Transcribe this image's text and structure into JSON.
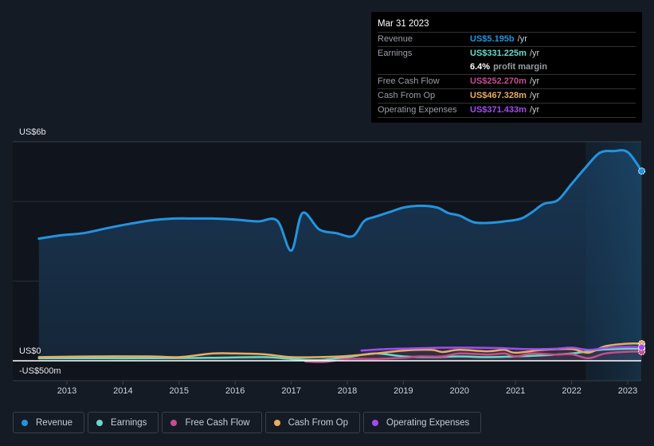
{
  "tooltip": {
    "date": "Mar 31 2023",
    "rows": [
      {
        "label": "Revenue",
        "value": "US$5.195b",
        "unit": "/yr",
        "color": "#2394df"
      },
      {
        "label": "Earnings",
        "value": "US$331.225m",
        "unit": "/yr",
        "color": "#6ad9c8"
      },
      {
        "label": "",
        "value": "6.4%",
        "unit": "profit margin",
        "color": "#ffffff"
      },
      {
        "label": "Free Cash Flow",
        "value": "US$252.270m",
        "unit": "/yr",
        "color": "#c84d8d"
      },
      {
        "label": "Cash From Op",
        "value": "US$467.328m",
        "unit": "/yr",
        "color": "#e8ad5f"
      },
      {
        "label": "Operating Expenses",
        "value": "US$371.433m",
        "unit": "/yr",
        "color": "#a24cf0"
      }
    ]
  },
  "legend": [
    {
      "label": "Revenue",
      "color": "#2394df"
    },
    {
      "label": "Earnings",
      "color": "#6ad9c8"
    },
    {
      "label": "Free Cash Flow",
      "color": "#c84d8d"
    },
    {
      "label": "Cash From Op",
      "color": "#e8ad5f"
    },
    {
      "label": "Operating Expenses",
      "color": "#a24cf0"
    }
  ],
  "chart_data": {
    "type": "area",
    "title": "",
    "xlabel": "",
    "ylabel": "",
    "y_tick_labels": [
      "US$6b",
      "US$0",
      "-US$500m"
    ],
    "x_tick_labels": [
      "2013",
      "2014",
      "2015",
      "2016",
      "2017",
      "2018",
      "2019",
      "2020",
      "2021",
      "2022",
      "2023"
    ],
    "ylim": [
      -0.5,
      6.0
    ],
    "xlim": [
      2012.5,
      2023.25
    ],
    "units": "US$ billions",
    "forecast_shade_start": 2022.25,
    "series": [
      {
        "name": "Revenue",
        "color": "#2394df",
        "x": [
          2012.5,
          2012.9,
          2013.3,
          2013.7,
          2014.1,
          2014.5,
          2014.9,
          2015.2,
          2015.6,
          2016.0,
          2016.4,
          2016.75,
          2017.0,
          2017.2,
          2017.5,
          2017.8,
          2018.1,
          2018.3,
          2018.5,
          2018.8,
          2019.0,
          2019.3,
          2019.6,
          2019.8,
          2020.0,
          2020.25,
          2020.5,
          2020.8,
          2021.1,
          2021.3,
          2021.5,
          2021.75,
          2022.0,
          2022.25,
          2022.5,
          2022.75,
          2023.0,
          2023.25
        ],
        "values": [
          3.35,
          3.44,
          3.5,
          3.63,
          3.75,
          3.85,
          3.9,
          3.9,
          3.9,
          3.87,
          3.82,
          3.84,
          3.02,
          4.05,
          3.6,
          3.5,
          3.42,
          3.83,
          3.95,
          4.1,
          4.2,
          4.25,
          4.2,
          4.05,
          3.98,
          3.8,
          3.78,
          3.82,
          3.9,
          4.08,
          4.3,
          4.4,
          4.85,
          5.3,
          5.7,
          5.75,
          5.72,
          5.2
        ]
      },
      {
        "name": "Earnings",
        "color": "#6ad9c8",
        "x": [
          2012.5,
          2013.5,
          2014.5,
          2015.5,
          2016.5,
          2017.0,
          2017.5,
          2018.0,
          2018.5,
          2019.0,
          2019.5,
          2020.0,
          2020.5,
          2021.0,
          2021.5,
          2022.0,
          2022.5,
          2023.0,
          2023.25
        ],
        "values": [
          0.07,
          0.07,
          0.07,
          0.08,
          0.1,
          0.05,
          0.02,
          0.1,
          0.2,
          0.12,
          0.1,
          0.12,
          0.1,
          0.12,
          0.15,
          0.2,
          0.3,
          0.33,
          0.33
        ]
      },
      {
        "name": "Free Cash Flow",
        "color": "#c84d8d",
        "x": [
          2017.25,
          2017.6,
          2018.0,
          2018.5,
          2019.0,
          2019.3,
          2019.7,
          2020.0,
          2020.5,
          2020.8,
          2021.0,
          2021.3,
          2021.7,
          2022.0,
          2022.3,
          2022.6,
          2023.0,
          2023.25
        ],
        "values": [
          -0.02,
          -0.03,
          0.05,
          0.05,
          0.08,
          0.12,
          0.12,
          0.2,
          0.17,
          0.2,
          0.12,
          0.2,
          0.17,
          0.18,
          0.07,
          0.2,
          0.25,
          0.25
        ]
      },
      {
        "name": "Cash From Op",
        "color": "#e8ad5f",
        "x": [
          2012.5,
          2013.5,
          2014.5,
          2015.0,
          2015.6,
          2016.0,
          2016.5,
          2017.0,
          2017.5,
          2018.0,
          2018.5,
          2019.0,
          2019.5,
          2019.7,
          2020.0,
          2020.5,
          2020.8,
          2021.0,
          2021.5,
          2022.0,
          2022.3,
          2022.6,
          2023.0,
          2023.25
        ],
        "values": [
          0.1,
          0.12,
          0.12,
          0.1,
          0.2,
          0.2,
          0.18,
          0.1,
          0.1,
          0.13,
          0.2,
          0.28,
          0.3,
          0.24,
          0.3,
          0.26,
          0.3,
          0.22,
          0.3,
          0.32,
          0.22,
          0.4,
          0.47,
          0.47
        ]
      },
      {
        "name": "Operating Expenses",
        "color": "#a24cf0",
        "x": [
          2018.25,
          2018.7,
          2019.2,
          2019.7,
          2020.2,
          2020.7,
          2021.2,
          2021.7,
          2022.0,
          2022.3,
          2022.6,
          2023.0,
          2023.25
        ],
        "values": [
          0.28,
          0.32,
          0.34,
          0.36,
          0.36,
          0.35,
          0.32,
          0.33,
          0.36,
          0.3,
          0.35,
          0.38,
          0.37
        ]
      }
    ]
  }
}
